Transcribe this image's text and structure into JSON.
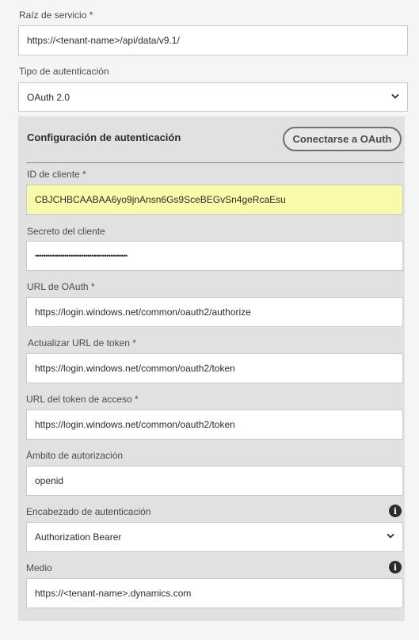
{
  "service_root": {
    "label": "Raíz de servicio *",
    "value": "https://<tenant-name>/api/data/v9.1/"
  },
  "auth_type": {
    "label": "Tipo de autenticación",
    "value": "OAuth 2.0"
  },
  "auth_config": {
    "title": "Configuración de autenticación",
    "connect_button": "Conectarse a OAuth",
    "client_id": {
      "label": "ID de cliente *",
      "value": "CBJCHBCAABAA6yo9jnAnsn6Gs9SceBEGvSn4geRcaEsu"
    },
    "client_secret": {
      "label": "Secreto del cliente",
      "value": "••••••••••••••••••••••••••••••••••••••••••••"
    },
    "oauth_url": {
      "label": "URL de OAuth *",
      "value": "https://login.windows.net/common/oauth2/authorize"
    },
    "refresh_token_url": {
      "label": "Actualizar URL de token *",
      "value": "https://login.windows.net/common/oauth2/token"
    },
    "access_token_url": {
      "label": "URL del token de acceso *",
      "value": "https://login.windows.net/common/oauth2/token"
    },
    "scope": {
      "label": "Ámbito de autorización",
      "value": "openid"
    },
    "auth_header": {
      "label": "Encabezado de autenticación",
      "value": "Authorization Bearer"
    },
    "resource": {
      "label": "Medio",
      "value": "https://<tenant-name>.dynamics.com"
    }
  },
  "icons": {
    "chevron": "chevron-down-icon",
    "info": "info-icon"
  }
}
